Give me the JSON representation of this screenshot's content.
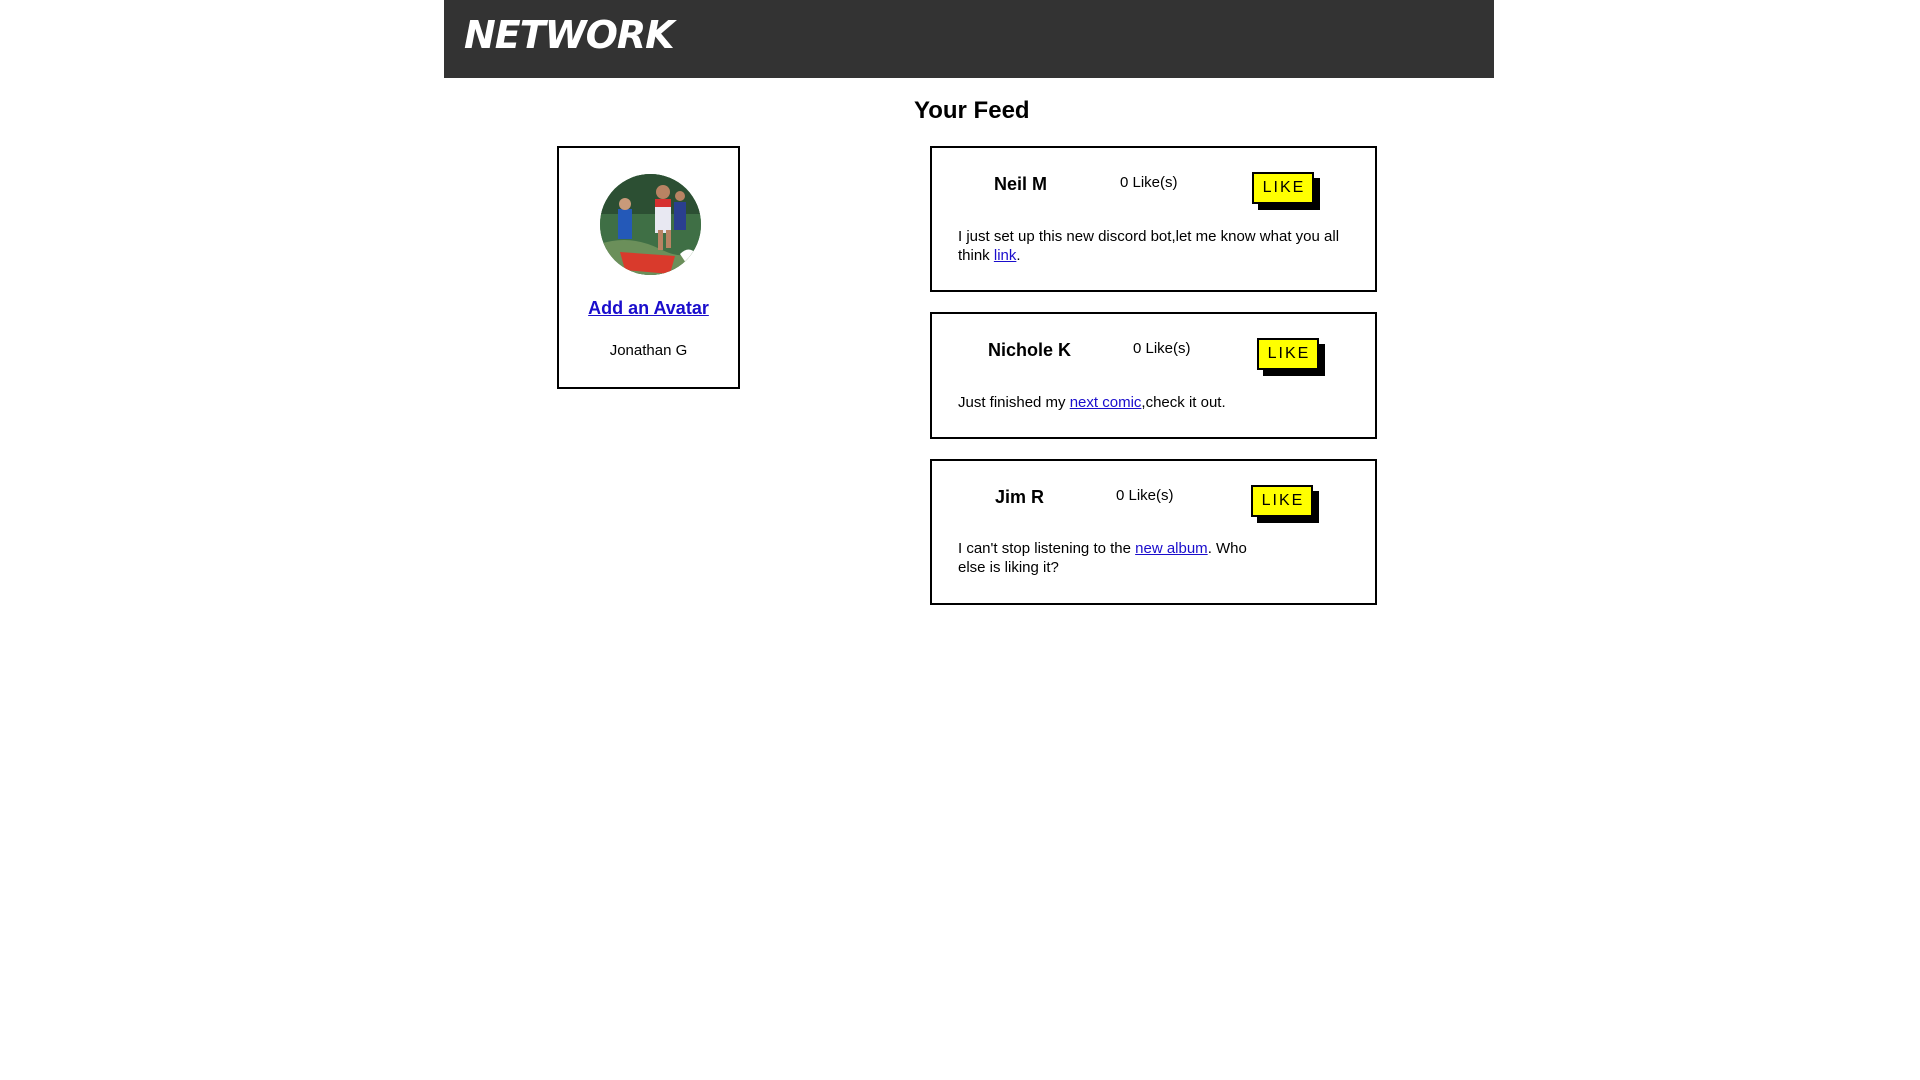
{
  "header": {
    "logo_text": "NETWORK",
    "background": "#333333"
  },
  "feed": {
    "title": "Your Feed"
  },
  "profile": {
    "add_avatar_label": "Add an Avatar",
    "name": "Jonathan G"
  },
  "posts": [
    {
      "author": "Neil M",
      "likes": "0 Like(s)",
      "like_label": "LIKE",
      "text_before": "I just set up this new discord bot,let me know what you all think ",
      "link_text": "link",
      "text_after": "."
    },
    {
      "author": "Nichole K",
      "likes": "0 Like(s)",
      "like_label": "LIKE",
      "text_before": "Just finished my ",
      "link_text": "next comic",
      "text_after": ",check it out."
    },
    {
      "author": "Jim R",
      "likes": "0 Like(s)",
      "like_label": "LIKE",
      "text_before": "I can't stop listening to the ",
      "link_text": "new album",
      "text_after": ". Who else is liking it?"
    }
  ],
  "colors": {
    "like_button": "#ffff00",
    "link": "#1a0dcc"
  }
}
